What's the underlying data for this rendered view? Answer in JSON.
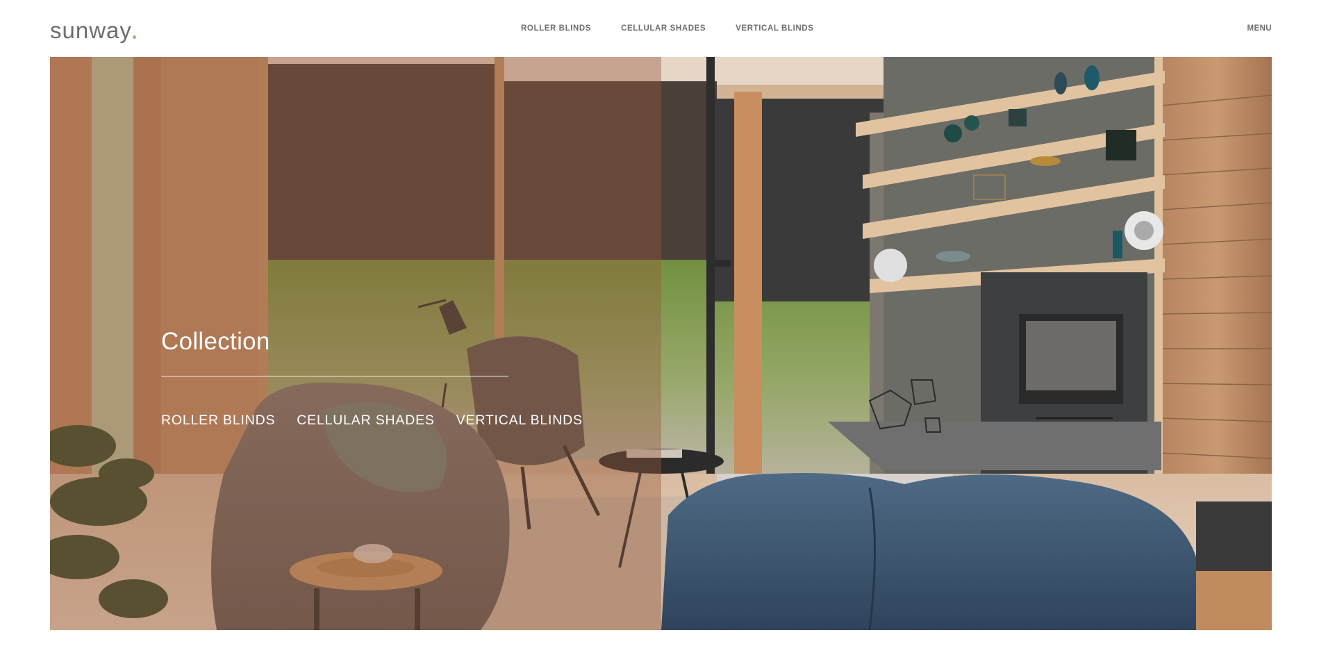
{
  "header": {
    "logo_text": "sunway",
    "nav": [
      {
        "label": "ROLLER BLINDS"
      },
      {
        "label": "CELLULAR SHADES"
      },
      {
        "label": "VERTICAL BLINDS"
      }
    ],
    "menu_label": "MENU"
  },
  "hero": {
    "title": "Collection",
    "links": [
      {
        "label": "ROLLER BLINDS"
      },
      {
        "label": "CELLULAR SHADES"
      },
      {
        "label": "VERTICAL BLINDS"
      }
    ],
    "scroll_icon": "chevron-down-icon"
  },
  "colors": {
    "logo": "#6d6d6d",
    "logo_accent": "#c9a37a",
    "nav_text": "#6e6e6e",
    "left_overlay": "#96593c",
    "hero_text": "#ffffff"
  }
}
